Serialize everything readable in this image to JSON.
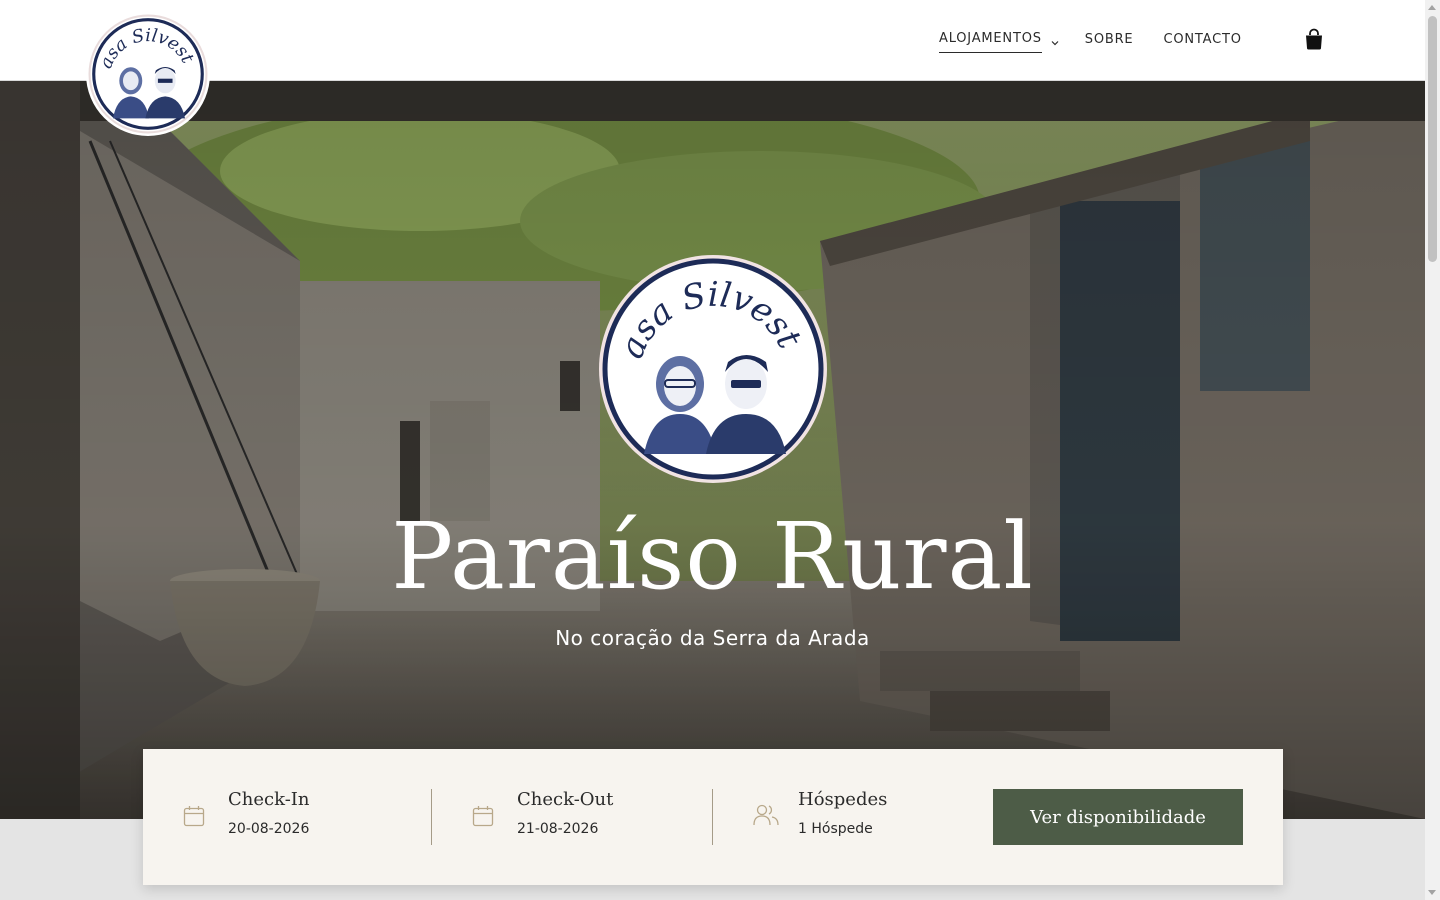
{
  "brand": {
    "name": "Casa Silvestre"
  },
  "nav": {
    "items": [
      {
        "label": "ALOJAMENTOS",
        "active": true,
        "has_dropdown": true
      },
      {
        "label": "SOBRE"
      },
      {
        "label": "CONTACTO"
      }
    ],
    "cart_icon": "shopping-bag-icon"
  },
  "hero": {
    "title": "Paraíso Rural",
    "subtitle": "No coração da Serra da Arada"
  },
  "booking": {
    "checkin": {
      "label": "Check-In",
      "value": "20-08-2026",
      "icon": "calendar-icon"
    },
    "checkout": {
      "label": "Check-Out",
      "value": "21-08-2026",
      "icon": "calendar-icon"
    },
    "guests": {
      "label": "Hóspedes",
      "value": "1 Hóspede",
      "icon": "users-icon"
    },
    "button_label": "Ver disponibilidade"
  },
  "colors": {
    "accent": "#4d5c47",
    "booking_bg": "#f7f4ef",
    "logo_navy": "#2a3b6b"
  }
}
